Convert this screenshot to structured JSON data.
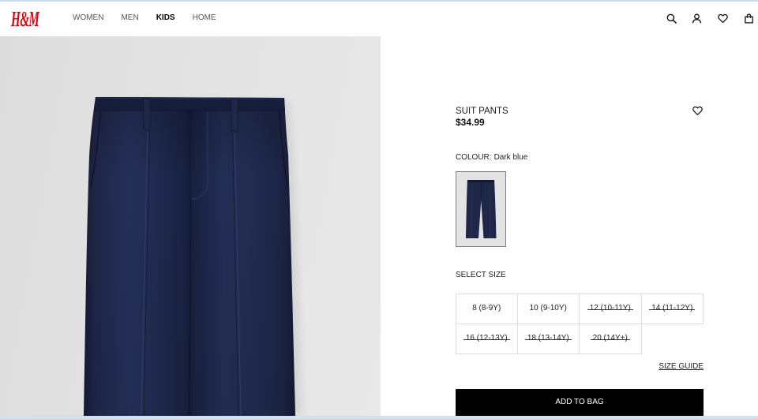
{
  "header": {
    "logo_text": "H&M",
    "nav": [
      {
        "label": "WOMEN",
        "active": false
      },
      {
        "label": "MEN",
        "active": false
      },
      {
        "label": "KIDS",
        "active": true
      },
      {
        "label": "HOME",
        "active": false
      }
    ],
    "icons": [
      "search-icon",
      "account-icon",
      "heart-icon",
      "shopping-bag-icon"
    ]
  },
  "product": {
    "name": "SUIT PANTS",
    "price": "$34.99",
    "colour_label": "COLOUR:",
    "colour_value": "Dark blue",
    "swatches": [
      {
        "selected": true
      }
    ],
    "select_size_label": "SELECT SIZE",
    "sizes": [
      {
        "label": "8 (8-9Y)",
        "available": true
      },
      {
        "label": "10 (9-10Y)",
        "available": true
      },
      {
        "label": "12 (10-11Y)",
        "available": false
      },
      {
        "label": "14 (11-12Y)",
        "available": false
      },
      {
        "label": "16 (12-13Y)",
        "available": false
      },
      {
        "label": "18 (13-14Y)",
        "available": false
      },
      {
        "label": "20 (14Y+)",
        "available": false
      }
    ],
    "size_guide_label": "SIZE GUIDE",
    "add_to_bag_label": "ADD TO BAG"
  },
  "colors": {
    "brand_red": "#e50010",
    "product_navy": "#1e2747",
    "add_to_bag_background": "#000000",
    "add_to_bag_text": "#ffffff"
  }
}
